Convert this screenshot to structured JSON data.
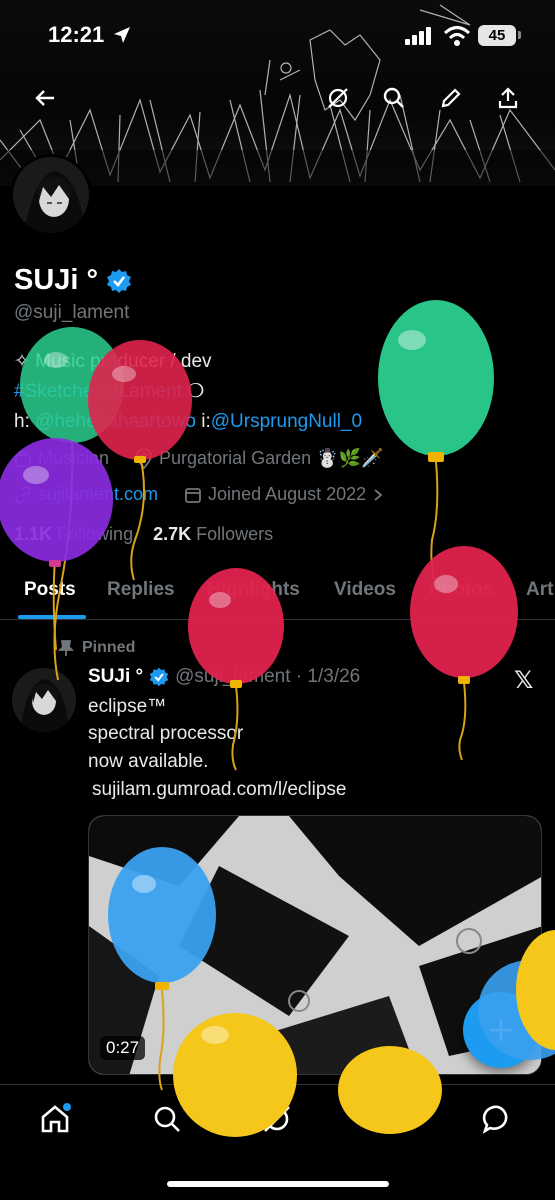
{
  "status_bar": {
    "time": "12:21",
    "battery": "45"
  },
  "header": {
    "back_icon": "arrow-left-icon",
    "grok_icon": "grok-icon",
    "search_icon": "search-icon",
    "edit_icon": "pencil-icon",
    "share_icon": "share-icon"
  },
  "profile": {
    "name": "SUJi °",
    "handle": "@suji_lament",
    "bio_line1": "✧ Music producer / dev",
    "bio_hashtag": "#SketchesofLament",
    "bio_hashtag_suffix": " ❍",
    "bio_line3_prefix": "h: ",
    "bio_mention1": "@hehehahaartowo",
    "bio_line3_mid": " i:",
    "bio_mention2": "@UrsprungNull_0",
    "category": "Musician",
    "location": "Purgatorial Garden ☃️🌿🗡️",
    "website": "sujilament.com",
    "joined": "Joined August 2022",
    "following_count": "1.1K",
    "following_label": "Following",
    "followers_count": "2.7K",
    "followers_label": "Followers"
  },
  "tabs": [
    "Posts",
    "Replies",
    "Highlights",
    "Videos",
    "Photos",
    "Art"
  ],
  "active_tab": "Posts",
  "tweet": {
    "pinned_label": "Pinned",
    "author": "SUJi °",
    "handle_date": "@suji_lament · 1/3/26",
    "line1": "eclipse™",
    "line2": "spectral processor",
    "line3": "now available.",
    "link": "sujilam.gumroad.com/l/eclipse",
    "video_duration": "0:27",
    "platform_icon": "x-logo-icon"
  },
  "fab": {
    "icon": "plus-icon"
  },
  "bottom_nav": [
    "home-icon",
    "search-icon",
    "grok-icon",
    "notifications-bell-icon",
    "messages-icon"
  ],
  "colors": {
    "accent": "#1d9bf0",
    "background": "#000000",
    "muted": "#71767b",
    "text": "#e7e9ea"
  }
}
